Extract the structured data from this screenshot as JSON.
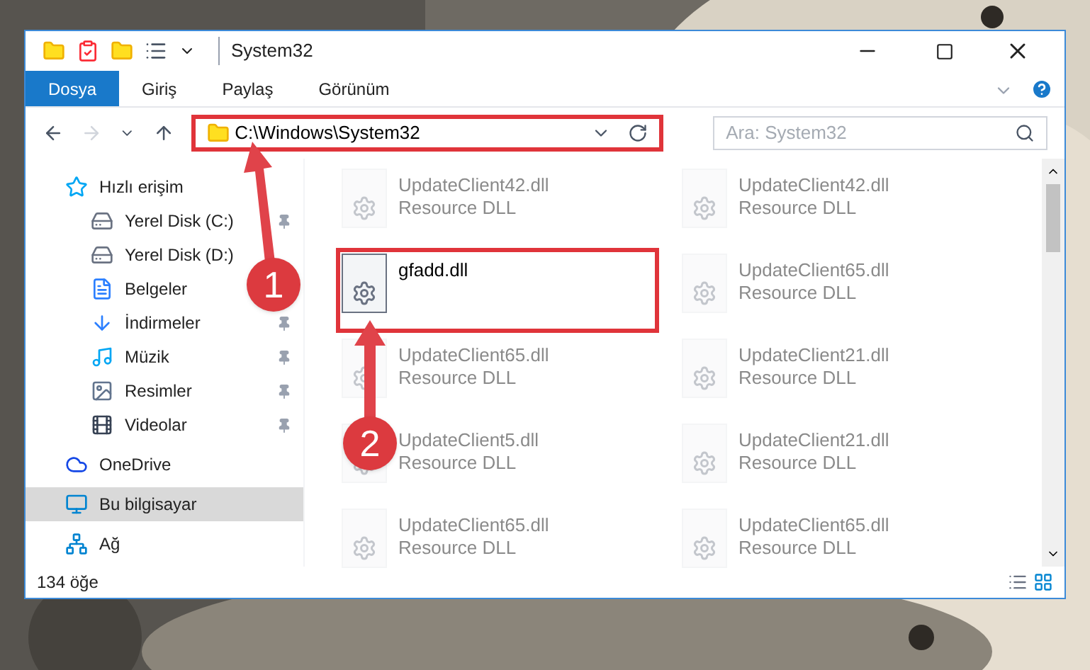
{
  "window": {
    "title": "System32"
  },
  "tabs": [
    {
      "label": "Dosya",
      "selected": true
    },
    {
      "label": "Giriş",
      "selected": false
    },
    {
      "label": "Paylaş",
      "selected": false
    },
    {
      "label": "Görünüm",
      "selected": false
    }
  ],
  "address": {
    "path": "C:\\Windows\\System32",
    "highlighted": true
  },
  "search": {
    "placeholder": "Ara: System32"
  },
  "sidebar": {
    "items": [
      {
        "label": "Hızlı erişim",
        "selected": false,
        "children": [
          {
            "label": "Yerel Disk (C:)",
            "pinned": true
          },
          {
            "label": "Yerel Disk (D:)",
            "pinned": false
          },
          {
            "label": "Belgeler",
            "pinned": false
          },
          {
            "label": "İndirmeler",
            "pinned": true
          },
          {
            "label": "Müzik",
            "pinned": true
          },
          {
            "label": "Resimler",
            "pinned": true
          },
          {
            "label": "Videolar",
            "pinned": true
          }
        ]
      },
      {
        "label": "OneDrive",
        "selected": false
      },
      {
        "label": "Bu bilgisayar",
        "selected": true
      },
      {
        "label": "Ağ",
        "selected": false
      }
    ]
  },
  "files": [
    {
      "name": "UpdateClient42.dll",
      "type": "Resource DLL",
      "faded": true,
      "highlighted": false
    },
    {
      "name": "UpdateClient42.dll",
      "type": "Resource DLL",
      "faded": true,
      "highlighted": false
    },
    {
      "name": "gfadd.dll",
      "faded": false,
      "highlighted": true
    },
    {
      "name": "UpdateClient65.dll",
      "type": "Resource DLL",
      "faded": true,
      "highlighted": false
    },
    {
      "name": "UpdateClient65.dll",
      "type": "Resource DLL",
      "faded": true,
      "highlighted": false
    },
    {
      "name": "UpdateClient21.dll",
      "type": "Resource DLL",
      "faded": true,
      "highlighted": false
    },
    {
      "name": "UpdateClient5.dll",
      "type": "Resource DLL",
      "faded": true,
      "highlighted": false
    },
    {
      "name": "UpdateClient21.dll",
      "type": "Resource DLL",
      "faded": true,
      "highlighted": false
    },
    {
      "name": "UpdateClient65.dll",
      "type": "Resource DLL",
      "faded": true,
      "highlighted": false
    },
    {
      "name": "UpdateClient65.dll",
      "type": "Resource DLL",
      "faded": true,
      "highlighted": false
    }
  ],
  "status_bar": {
    "count": "134 öğe"
  },
  "annotations": [
    {
      "number": "1"
    },
    {
      "number": "2"
    }
  ]
}
